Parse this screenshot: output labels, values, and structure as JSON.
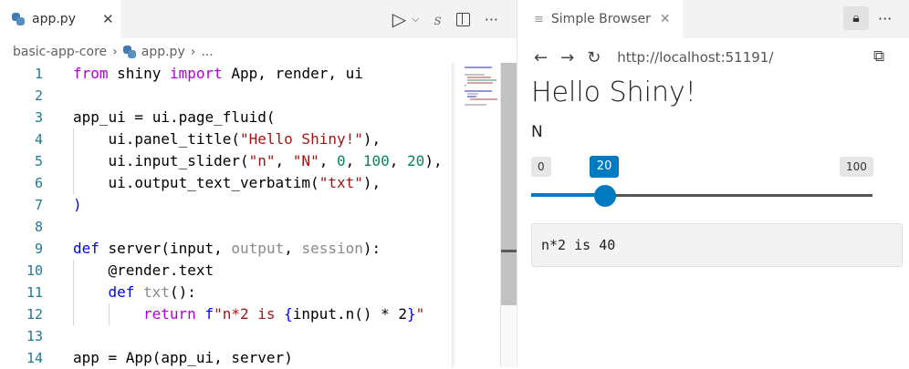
{
  "editor": {
    "tab_label": "app.py",
    "close_glyph": "✕",
    "toolbar": {
      "run": "▷",
      "run_menu": "⌵",
      "more": "···"
    },
    "breadcrumb": [
      "basic-app-core",
      "app.py",
      "..."
    ],
    "lines": [
      {
        "n": "1",
        "ind": 0,
        "tokens": [
          [
            "from",
            "ctl"
          ],
          [
            " shiny ",
            "tx"
          ],
          [
            "import",
            "ctl"
          ],
          [
            " App, render, ui",
            "tx"
          ]
        ]
      },
      {
        "n": "2",
        "ind": 0,
        "tokens": []
      },
      {
        "n": "3",
        "ind": 0,
        "tokens": [
          [
            "app_ui = ui.page_fluid(",
            "tx"
          ]
        ]
      },
      {
        "n": "4",
        "ind": 1,
        "tokens": [
          [
            "ui.panel_title(",
            "tx"
          ],
          [
            "\"Hello Shiny!\"",
            "str"
          ],
          [
            "),",
            "tx"
          ]
        ]
      },
      {
        "n": "5",
        "ind": 1,
        "tokens": [
          [
            "ui.input_slider(",
            "tx"
          ],
          [
            "\"n\"",
            "str"
          ],
          [
            ", ",
            "tx"
          ],
          [
            "\"N\"",
            "str"
          ],
          [
            ", ",
            "tx"
          ],
          [
            "0",
            "num"
          ],
          [
            ", ",
            "tx"
          ],
          [
            "100",
            "num"
          ],
          [
            ", ",
            "tx"
          ],
          [
            "20",
            "num"
          ],
          [
            "),",
            "tx"
          ]
        ]
      },
      {
        "n": "6",
        "ind": 1,
        "tokens": [
          [
            "ui.output_text_verbatim(",
            "tx"
          ],
          [
            "\"txt\"",
            "str"
          ],
          [
            "),",
            "tx"
          ]
        ]
      },
      {
        "n": "7",
        "ind": 0,
        "tokens": [
          [
            ")",
            "kw"
          ]
        ]
      },
      {
        "n": "8",
        "ind": 0,
        "tokens": []
      },
      {
        "n": "9",
        "ind": 0,
        "tokens": [
          [
            "def",
            "kw"
          ],
          [
            " server(input, ",
            "tx"
          ],
          [
            "output",
            "dim"
          ],
          [
            ", ",
            "tx"
          ],
          [
            "session",
            "dim"
          ],
          [
            "):",
            "tx"
          ]
        ]
      },
      {
        "n": "10",
        "ind": 1,
        "tokens": [
          [
            "@render.text",
            "tx"
          ]
        ]
      },
      {
        "n": "11",
        "ind": 1,
        "tokens": [
          [
            "def",
            "kw"
          ],
          [
            " ",
            "tx"
          ],
          [
            "txt",
            "dim"
          ],
          [
            "():",
            "tx"
          ]
        ]
      },
      {
        "n": "12",
        "ind": 2,
        "tokens": [
          [
            "return",
            "ctl"
          ],
          [
            " ",
            "tx"
          ],
          [
            "f",
            "kw"
          ],
          [
            "\"n*2 is ",
            "str"
          ],
          [
            "{",
            "kw"
          ],
          [
            "input.n() * 2",
            "tx"
          ],
          [
            "}",
            "kw"
          ],
          [
            "\"",
            "str"
          ]
        ]
      },
      {
        "n": "13",
        "ind": 0,
        "tokens": []
      },
      {
        "n": "14",
        "ind": 0,
        "tokens": [
          [
            "app = App(app_ui, server)",
            "tx"
          ]
        ]
      }
    ]
  },
  "browser": {
    "tab_label": "Simple Browser",
    "close_glyph": "✕",
    "lock": "🔒︎",
    "more": "···",
    "back": "←",
    "forward": "→",
    "reload": "↻",
    "url": "http://localhost:51191/",
    "open_external": "⧉",
    "page": {
      "title": "Hello Shiny!",
      "slider": {
        "label": "N",
        "min": 0,
        "max": 100,
        "value": 20,
        "min_label": "0",
        "max_label": "100",
        "value_label": "20"
      },
      "output": "n*2 is 40"
    },
    "accent": "#007bc2"
  }
}
